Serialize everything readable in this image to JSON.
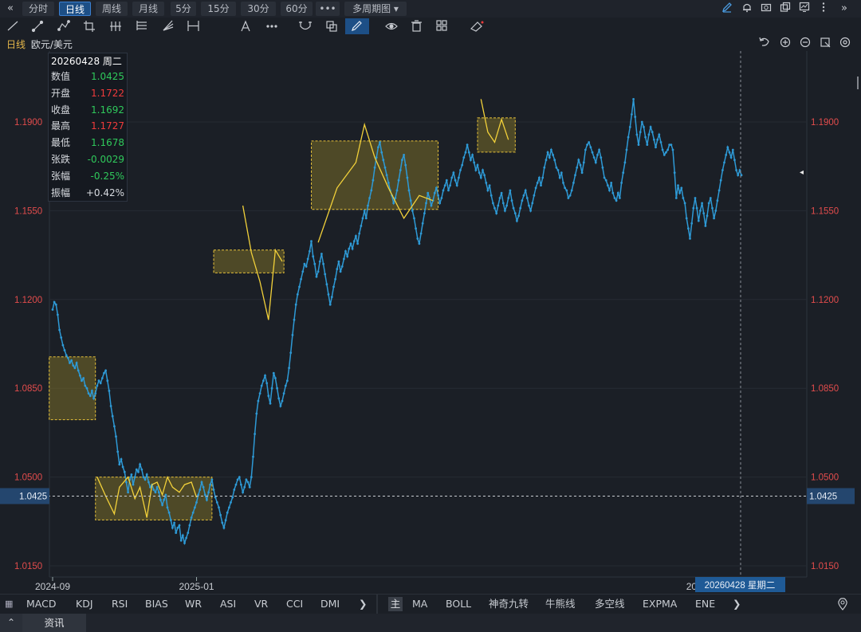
{
  "toolbar": {
    "left_arrow": "«",
    "right_arrow": "»",
    "periods": [
      {
        "label": "分时",
        "active": false
      },
      {
        "label": "日线",
        "active": true
      },
      {
        "label": "周线",
        "active": false
      },
      {
        "label": "月线",
        "active": false
      },
      {
        "label": "5分",
        "active": false
      },
      {
        "label": "15分",
        "active": false
      },
      {
        "label": "30分",
        "active": false
      },
      {
        "label": "60分",
        "active": false
      }
    ],
    "more_label": "•••",
    "multi_period_label": "多周期图 ▾",
    "draw_tools": [
      "line-tool-icon",
      "ray-tool-icon",
      "polyline-tool-icon",
      "crop-tool-icon",
      "parallel-tool-icon",
      "channel-tool-icon",
      "fan-tool-icon",
      "measure-tool-icon",
      "text-tool-icon",
      "more-tools-icon",
      "magnet-icon",
      "copy-icon",
      "pen-icon",
      "eye-icon",
      "trash-icon",
      "layers-icon",
      "eraser-icon"
    ]
  },
  "chart_header": {
    "period": "日线",
    "symbol": "欧元/美元"
  },
  "info": {
    "date": "20260428 周二",
    "rows": [
      {
        "k": "数值",
        "v": "1.0425",
        "color": "#2fc95b"
      },
      {
        "k": "开盘",
        "v": "1.1722",
        "color": "#ef3b3b"
      },
      {
        "k": "收盘",
        "v": "1.1692",
        "color": "#2fc95b"
      },
      {
        "k": "最高",
        "v": "1.1727",
        "color": "#ef3b3b"
      },
      {
        "k": "最低",
        "v": "1.1678",
        "color": "#2fc95b"
      },
      {
        "k": "张跌",
        "v": "-0.0029",
        "color": "#2fc95b"
      },
      {
        "k": "张幅",
        "v": "-0.25%",
        "color": "#2fc95b"
      },
      {
        "k": "振幅",
        "v": "+0.42%",
        "color": "#d8dbe0"
      }
    ]
  },
  "chart_data": {
    "type": "line",
    "title": "",
    "xlabel": "",
    "ylabel": "",
    "ylim": [
      1.015,
      1.205
    ],
    "yticks": [
      1.015,
      1.05,
      1.085,
      1.12,
      1.155,
      1.19
    ],
    "ytick_labels": [
      "1.0150",
      "1.0500",
      "1.0850",
      "1.1200",
      "1.1550",
      "1.1900"
    ],
    "xticks": [
      {
        "label": "2024-09",
        "idx": 0
      },
      {
        "label": "2025-01",
        "idx": 84
      },
      {
        "label": "2026-01",
        "idx": 380
      }
    ],
    "crosshair": {
      "value": 1.0425,
      "value_label": "1.0425",
      "idx": 492,
      "date_label": "20260428 星期二"
    },
    "series": [
      {
        "values": [
          1.116,
          1.119,
          1.118,
          1.114,
          1.108,
          1.105,
          1.102,
          1.1,
          1.098,
          1.097,
          1.095,
          1.096,
          1.094,
          1.093,
          1.095,
          1.092,
          1.09,
          1.088,
          1.089,
          1.086,
          1.085,
          1.083,
          1.082,
          1.084,
          1.081,
          1.083,
          1.086,
          1.088,
          1.087,
          1.089,
          1.091,
          1.092,
          1.088,
          1.084,
          1.078,
          1.074,
          1.07,
          1.066,
          1.06,
          1.055,
          1.057,
          1.054,
          1.052,
          1.048,
          1.044,
          1.049,
          1.051,
          1.047,
          1.05,
          1.053,
          1.052,
          1.055,
          1.053,
          1.05,
          1.049,
          1.051,
          1.048,
          1.046,
          1.047,
          1.045,
          1.044,
          1.046,
          1.044,
          1.041,
          1.039,
          1.041,
          1.043,
          1.038,
          1.036,
          1.033,
          1.03,
          1.032,
          1.028,
          1.03,
          1.031,
          1.025,
          1.027,
          1.024,
          1.026,
          1.028,
          1.031,
          1.034,
          1.036,
          1.038,
          1.04,
          1.043,
          1.045,
          1.048,
          1.046,
          1.043,
          1.041,
          1.044,
          1.047,
          1.049,
          1.045,
          1.042,
          1.04,
          1.038,
          1.035,
          1.032,
          1.03,
          1.033,
          1.036,
          1.038,
          1.04,
          1.042,
          1.045,
          1.047,
          1.049,
          1.05,
          1.047,
          1.044,
          1.046,
          1.049,
          1.048,
          1.046,
          1.05,
          1.058,
          1.067,
          1.075,
          1.08,
          1.083,
          1.086,
          1.088,
          1.09,
          1.087,
          1.082,
          1.079,
          1.085,
          1.091,
          1.089,
          1.085,
          1.081,
          1.078,
          1.08,
          1.083,
          1.086,
          1.088,
          1.093,
          1.099,
          1.106,
          1.112,
          1.118,
          1.122,
          1.125,
          1.128,
          1.131,
          1.134,
          1.133,
          1.136,
          1.139,
          1.143,
          1.137,
          1.134,
          1.129,
          1.131,
          1.135,
          1.138,
          1.134,
          1.13,
          1.126,
          1.122,
          1.118,
          1.121,
          1.125,
          1.128,
          1.132,
          1.135,
          1.131,
          1.133,
          1.136,
          1.139,
          1.137,
          1.14,
          1.142,
          1.14,
          1.143,
          1.145,
          1.142,
          1.146,
          1.149,
          1.152,
          1.155,
          1.152,
          1.157,
          1.16,
          1.163,
          1.167,
          1.172,
          1.176,
          1.18,
          1.182,
          1.178,
          1.175,
          1.172,
          1.169,
          1.166,
          1.163,
          1.161,
          1.158,
          1.16,
          1.163,
          1.167,
          1.171,
          1.175,
          1.177,
          1.173,
          1.168,
          1.163,
          1.159,
          1.155,
          1.152,
          1.148,
          1.144,
          1.142,
          1.146,
          1.15,
          1.154,
          1.158,
          1.162,
          1.16,
          1.157,
          1.159,
          1.162,
          1.164,
          1.161,
          1.158,
          1.16,
          1.163,
          1.165,
          1.167,
          1.163,
          1.165,
          1.168,
          1.17,
          1.167,
          1.165,
          1.168,
          1.171,
          1.173,
          1.176,
          1.178,
          1.181,
          1.178,
          1.175,
          1.177,
          1.174,
          1.171,
          1.173,
          1.17,
          1.168,
          1.171,
          1.169,
          1.166,
          1.163,
          1.165,
          1.161,
          1.158,
          1.156,
          1.154,
          1.157,
          1.16,
          1.162,
          1.158,
          1.155,
          1.157,
          1.16,
          1.163,
          1.159,
          1.156,
          1.154,
          1.151,
          1.153,
          1.156,
          1.159,
          1.161,
          1.163,
          1.16,
          1.157,
          1.155,
          1.158,
          1.161,
          1.164,
          1.166,
          1.168,
          1.165,
          1.168,
          1.172,
          1.175,
          1.178,
          1.176,
          1.179,
          1.177,
          1.175,
          1.172,
          1.171,
          1.168,
          1.17,
          1.166,
          1.164,
          1.163,
          1.16,
          1.161,
          1.163,
          1.166,
          1.169,
          1.172,
          1.175,
          1.173,
          1.17,
          1.174,
          1.179,
          1.181,
          1.182,
          1.18,
          1.178,
          1.176,
          1.174,
          1.177,
          1.179,
          1.176,
          1.172,
          1.168,
          1.167,
          1.165,
          1.163,
          1.166,
          1.162,
          1.16,
          1.159,
          1.162,
          1.16,
          1.166,
          1.17,
          1.174,
          1.179,
          1.184,
          1.188,
          1.193,
          1.199,
          1.192,
          1.185,
          1.181,
          1.186,
          1.19,
          1.188,
          1.184,
          1.181,
          1.185,
          1.188,
          1.186,
          1.183,
          1.18,
          1.183,
          1.185,
          1.182,
          1.179,
          1.177,
          1.178,
          1.179,
          1.181,
          1.181,
          1.179,
          1.17,
          1.16,
          1.165,
          1.162,
          1.164,
          1.16,
          1.158,
          1.152,
          1.148,
          1.144,
          1.15,
          1.156,
          1.16,
          1.156,
          1.151,
          1.155,
          1.158,
          1.154,
          1.149,
          1.153,
          1.158,
          1.16,
          1.156,
          1.152,
          1.155,
          1.159,
          1.163,
          1.167,
          1.171,
          1.174,
          1.177,
          1.18,
          1.178,
          1.176,
          1.179,
          1.175,
          1.171,
          1.169,
          1.171,
          1.169
        ],
        "color": "#2e9ad6"
      }
    ],
    "boxes": [
      {
        "x0": -2,
        "x1": 25,
        "y0": 1.0726,
        "y1": 1.0974
      },
      {
        "x0": 25,
        "x1": 93,
        "y0": 1.0331,
        "y1": 1.05
      },
      {
        "x0": 94,
        "x1": 135,
        "y0": 1.1305,
        "y1": 1.1395
      },
      {
        "x0": 151,
        "x1": 225,
        "y0": 1.1555,
        "y1": 1.1825
      },
      {
        "x0": 248,
        "x1": 270,
        "y0": 1.1781,
        "y1": 1.1916
      }
    ],
    "zigzags": [
      {
        "points": [
          [
            26,
            1.05
          ],
          [
            31,
            1.0425
          ],
          [
            36,
            1.0355
          ],
          [
            39,
            1.046
          ],
          [
            44,
            1.05
          ],
          [
            48,
            1.0415
          ],
          [
            51,
            1.046
          ],
          [
            55,
            1.034
          ],
          [
            58,
            1.047
          ],
          [
            61,
            1.048
          ],
          [
            64,
            1.043
          ],
          [
            67,
            1.05
          ],
          [
            70,
            1.046
          ],
          [
            74,
            1.044
          ],
          [
            77,
            1.047
          ],
          [
            81,
            1.048
          ],
          [
            84,
            1.042
          ]
        ]
      },
      {
        "points": [
          [
            111,
            1.157
          ],
          [
            116,
            1.1385
          ],
          [
            121,
            1.127
          ],
          [
            126,
            1.112
          ],
          [
            130,
            1.1395
          ],
          [
            134,
            1.135
          ]
        ]
      },
      {
        "points": [
          [
            155,
            1.1425
          ],
          [
            166,
            1.164
          ],
          [
            177,
            1.174
          ],
          [
            182,
            1.189
          ],
          [
            188,
            1.176
          ],
          [
            196,
            1.164
          ],
          [
            205,
            1.152
          ],
          [
            214,
            1.161
          ],
          [
            222,
            1.159
          ]
        ]
      },
      {
        "points": [
          [
            250,
            1.199
          ],
          [
            254,
            1.186
          ],
          [
            258,
            1.182
          ],
          [
            262,
            1.191
          ],
          [
            266,
            1.183
          ]
        ]
      }
    ]
  },
  "chart_tools": [
    "undo-icon",
    "zoom-in-icon",
    "zoom-out-icon",
    "restore-icon",
    "settings-icon"
  ],
  "indicators_left": {
    "menu_icon": "▦",
    "items": [
      "MACD",
      "KDJ",
      "RSI",
      "BIAS",
      "WR",
      "ASI",
      "VR",
      "CCI",
      "DMI"
    ],
    "arrow": "❯"
  },
  "indicators_right": {
    "main_label": "主",
    "items": [
      "MA",
      "BOLL",
      "神奇九转",
      "牛熊线",
      "多空线",
      "EXPMA",
      "ENE"
    ],
    "arrow": "❯"
  },
  "news": {
    "collapse": "⌃",
    "label": "资讯"
  },
  "right_edge_marker": "◂"
}
